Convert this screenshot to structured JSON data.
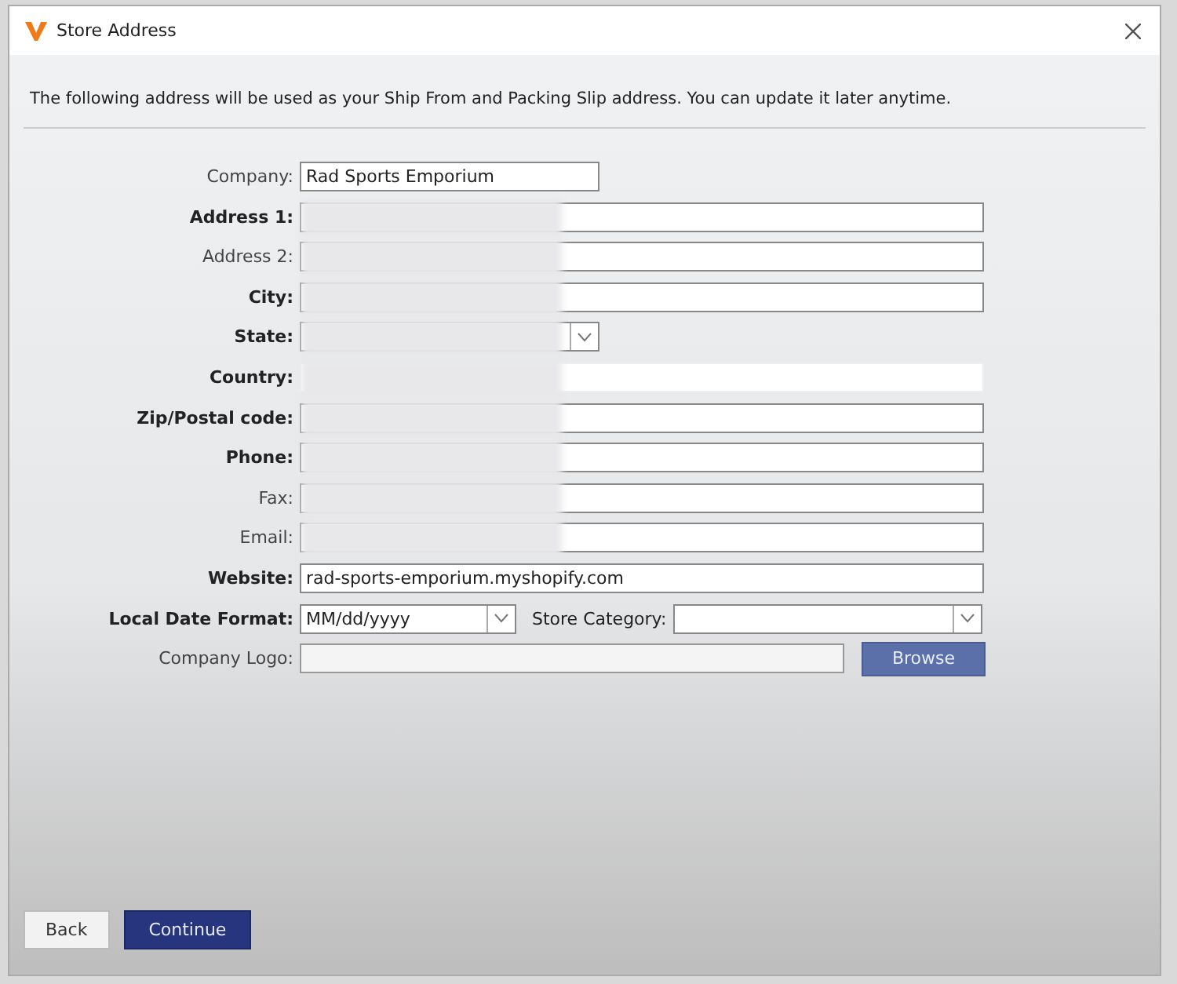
{
  "window": {
    "title": "Store Address"
  },
  "intro": "The following address will be used as your Ship From and Packing Slip address. You can update it later anytime.",
  "fields": [
    {
      "label": "Company:",
      "bold": false,
      "kind": "short-text",
      "value": "Rad Sports Emporium",
      "redacted": false,
      "disabled": false
    },
    {
      "label": "Address 1:",
      "bold": true,
      "kind": "text",
      "redacted": true,
      "disabled": false
    },
    {
      "label": "Address 2:",
      "bold": false,
      "kind": "text",
      "redacted": true,
      "disabled": false
    },
    {
      "label": "City:",
      "bold": true,
      "kind": "text",
      "redacted": true,
      "disabled": false
    },
    {
      "label": "State:",
      "bold": true,
      "kind": "short-select",
      "redacted": true,
      "disabled": false
    },
    {
      "label": "Country:",
      "bold": true,
      "kind": "text",
      "redacted": true,
      "disabled": true
    },
    {
      "label": "Zip/Postal code:",
      "bold": true,
      "kind": "text",
      "redacted": true,
      "disabled": false
    },
    {
      "label": "Phone:",
      "bold": true,
      "kind": "text",
      "redacted": true,
      "disabled": false
    },
    {
      "label": "Fax:",
      "bold": false,
      "kind": "text",
      "redacted": true,
      "disabled": false
    },
    {
      "label": "Email:",
      "bold": false,
      "kind": "text",
      "redacted": true,
      "disabled": false
    },
    {
      "label": "Website:",
      "bold": true,
      "kind": "text",
      "value": "rad-sports-emporium.myshopify.com",
      "redacted": false,
      "disabled": false
    },
    {
      "label": "Local Date Format:",
      "bold": true,
      "kind": "select-pair",
      "value": "MM/dd/yyyy",
      "second_label": "Store Category:",
      "redacted": false,
      "disabled": false
    },
    {
      "label": "Company Logo:",
      "bold": false,
      "kind": "file",
      "button": "Browse",
      "redacted": false,
      "disabled": false
    }
  ],
  "buttons": [
    {
      "label": "Back",
      "kind": "secondary"
    },
    {
      "label": "Continue",
      "kind": "primary"
    }
  ]
}
